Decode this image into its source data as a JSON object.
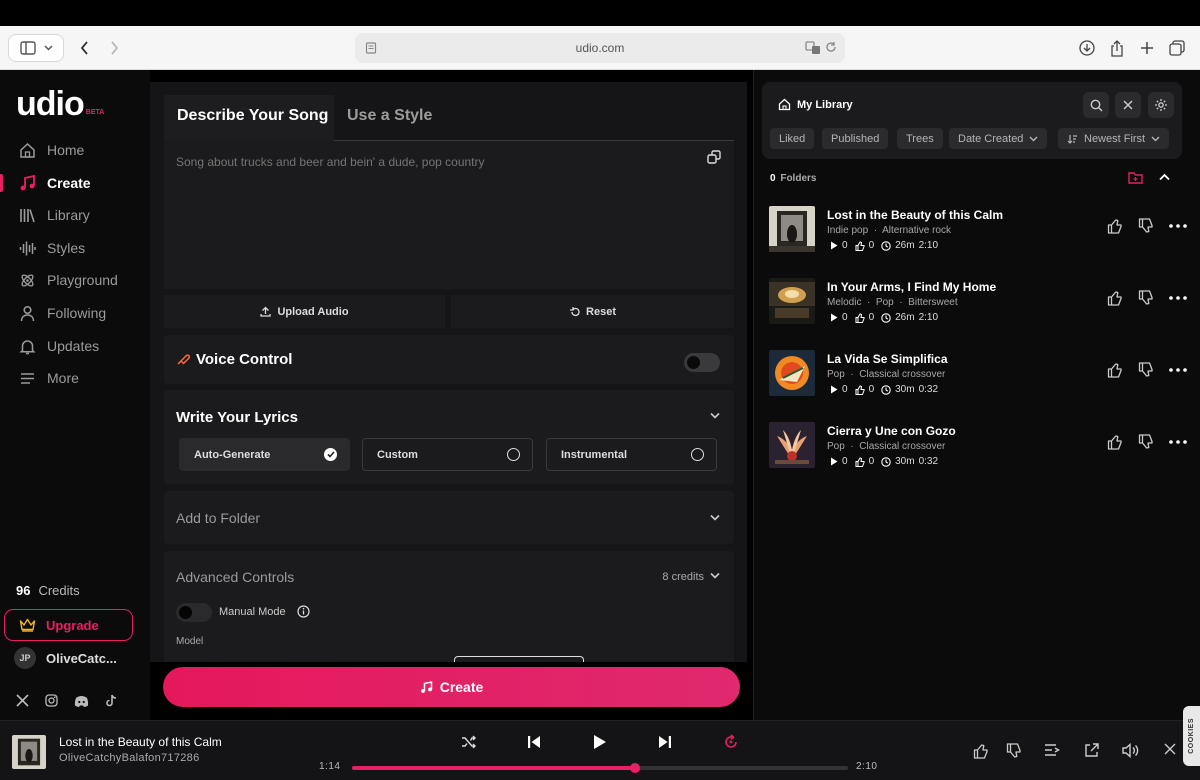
{
  "browser": {
    "url": "udio.com"
  },
  "brand": {
    "name": "udio",
    "badge": "BETA",
    "accent": "#e91e63"
  },
  "nav": {
    "items": [
      {
        "label": "Home",
        "icon": "home-icon"
      },
      {
        "label": "Create",
        "icon": "music-note-icon",
        "active": true
      },
      {
        "label": "Library",
        "icon": "library-icon"
      },
      {
        "label": "Styles",
        "icon": "waveform-icon"
      },
      {
        "label": "Playground",
        "icon": "playground-icon"
      },
      {
        "label": "Following",
        "icon": "user-icon"
      },
      {
        "label": "Updates",
        "icon": "bell-icon"
      },
      {
        "label": "More",
        "icon": "menu-icon"
      }
    ],
    "credits_count": "96",
    "credits_label": "Credits",
    "upgrade_label": "Upgrade",
    "user_initials": "JP",
    "user_name": "OliveCatc...",
    "socials": [
      "x-icon",
      "instagram-icon",
      "discord-icon",
      "tiktok-icon"
    ]
  },
  "create": {
    "tabs": [
      "Describe Your Song",
      "Use a Style"
    ],
    "prompt_placeholder": "Song about trucks and beer and bein' a dude, pop country",
    "upload_label": "Upload Audio",
    "reset_label": "Reset",
    "voice_control_label": "Voice Control",
    "lyrics_title": "Write Your Lyrics",
    "lyric_options": [
      "Auto-Generate",
      "Custom",
      "Instrumental"
    ],
    "lyric_selected": "Auto-Generate",
    "folder_title": "Add to Folder",
    "advanced_title": "Advanced Controls",
    "advanced_credits": "8 credits",
    "manual_mode_label": "Manual Mode",
    "model_label": "Model",
    "create_button": "Create"
  },
  "library": {
    "title": "My Library",
    "filters": [
      "Liked",
      "Published",
      "Trees"
    ],
    "sort_field": "Date Created",
    "sort_order": "Newest First",
    "folder_count": "0",
    "folder_label": "Folders",
    "songs": [
      {
        "title": "Lost in the Beauty of this Calm",
        "tags": [
          "Indie pop",
          "Alternative rock"
        ],
        "plays": "0",
        "likes": "0",
        "age": "26m",
        "duration": "2:10"
      },
      {
        "title": "In Your Arms, I Find My Home",
        "tags": [
          "Melodic",
          "Pop",
          "Bittersweet"
        ],
        "plays": "0",
        "likes": "0",
        "age": "26m",
        "duration": "2:10"
      },
      {
        "title": "La Vida Se Simplifica",
        "tags": [
          "Pop",
          "Classical crossover"
        ],
        "plays": "0",
        "likes": "0",
        "age": "30m",
        "duration": "0:32"
      },
      {
        "title": "Cierra y Une con Gozo",
        "tags": [
          "Pop",
          "Classical crossover"
        ],
        "plays": "0",
        "likes": "0",
        "age": "30m",
        "duration": "0:32"
      }
    ]
  },
  "player": {
    "title": "Lost in the Beauty of this Calm",
    "artist": "OliveCatchyBalafon717286",
    "current_time": "1:14",
    "duration": "2:10",
    "progress": 0.57
  },
  "cookies_label": "COOKIES"
}
